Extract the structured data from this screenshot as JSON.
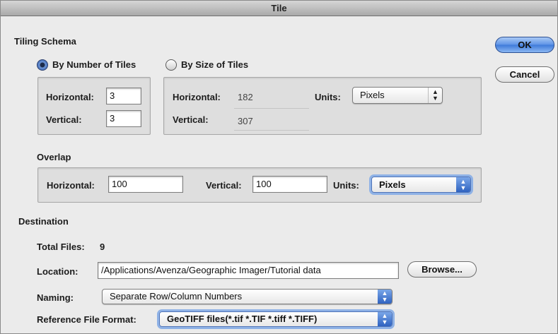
{
  "window": {
    "title": "Tile"
  },
  "buttons": {
    "ok": "OK",
    "cancel": "Cancel",
    "browse": "Browse..."
  },
  "tiling": {
    "heading": "Tiling Schema",
    "by_number": {
      "label": "By Number of Tiles",
      "selected": true,
      "horizontal_label": "Horizontal:",
      "horizontal_value": "3",
      "vertical_label": "Vertical:",
      "vertical_value": "3"
    },
    "by_size": {
      "label": "By Size of Tiles",
      "selected": false,
      "horizontal_label": "Horizontal:",
      "horizontal_value": "182",
      "vertical_label": "Vertical:",
      "vertical_value": "307",
      "units_label": "Units:",
      "units_value": "Pixels"
    }
  },
  "overlap": {
    "heading": "Overlap",
    "horizontal_label": "Horizontal:",
    "horizontal_value": "100",
    "vertical_label": "Vertical:",
    "vertical_value": "100",
    "units_label": "Units:",
    "units_value": "Pixels"
  },
  "destination": {
    "heading": "Destination",
    "total_files_label": "Total Files:",
    "total_files_value": "9",
    "location_label": "Location:",
    "location_value": "/Applications/Avenza/Geographic Imager/Tutorial data",
    "naming_label": "Naming:",
    "naming_value": "Separate Row/Column Numbers",
    "ref_format_label": "Reference File Format:",
    "ref_format_value": "GeoTIFF files(*.tif *.TIF *.tiff *.TIFF)"
  },
  "colors": {
    "accent": "#3e7ad9",
    "background": "#ebebeb"
  }
}
